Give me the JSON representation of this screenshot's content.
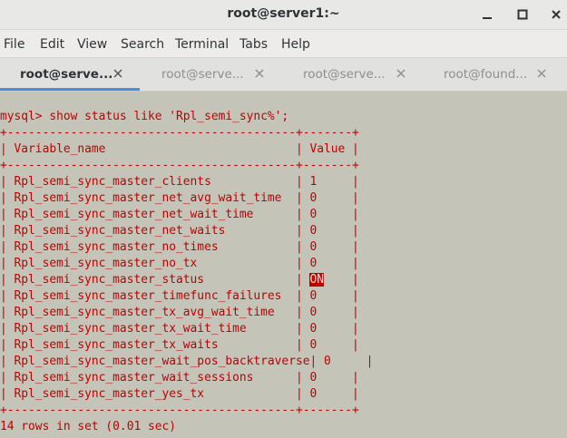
{
  "window": {
    "title": "root@server1:~"
  },
  "menu": [
    "File",
    "Edit",
    "View",
    "Search",
    "Terminal",
    "Tabs",
    "Help"
  ],
  "tabs": [
    {
      "label": "root@serve...",
      "active": true
    },
    {
      "label": "root@serve...",
      "active": false
    },
    {
      "label": "root@serve...",
      "active": false
    },
    {
      "label": "root@found...",
      "active": false
    }
  ],
  "terminal": {
    "command": "mysql> show status like 'Rpl_semi_sync%';",
    "border": "+-----------------------------------------+-------+",
    "header": "| Variable_name                           | Value |",
    "rows": [
      {
        "name": "Rpl_semi_sync_master_clients",
        "value": "1"
      },
      {
        "name": "Rpl_semi_sync_master_net_avg_wait_time",
        "value": "0"
      },
      {
        "name": "Rpl_semi_sync_master_net_wait_time",
        "value": "0"
      },
      {
        "name": "Rpl_semi_sync_master_net_waits",
        "value": "0"
      },
      {
        "name": "Rpl_semi_sync_master_no_times",
        "value": "0"
      },
      {
        "name": "Rpl_semi_sync_master_no_tx",
        "value": "0"
      },
      {
        "name": "Rpl_semi_sync_master_status",
        "value": "ON",
        "highlight": true
      },
      {
        "name": "Rpl_semi_sync_master_timefunc_failures",
        "value": "0"
      },
      {
        "name": "Rpl_semi_sync_master_tx_avg_wait_time",
        "value": "0"
      },
      {
        "name": "Rpl_semi_sync_master_tx_wait_time",
        "value": "0"
      },
      {
        "name": "Rpl_semi_sync_master_tx_waits",
        "value": "0"
      },
      {
        "name": "Rpl_semi_sync_master_wait_pos_backtraverse",
        "value": "0"
      },
      {
        "name": "Rpl_semi_sync_master_wait_sessions",
        "value": "0"
      },
      {
        "name": "Rpl_semi_sync_master_yes_tx",
        "value": "0"
      }
    ],
    "footer": "14 rows in set (0.01 sec)"
  },
  "colors": {
    "terminal_bg": "#c4c5b8",
    "terminal_fg": "#c00000",
    "accent": "#4a90d9"
  },
  "icons": [
    "minimize-icon",
    "maximize-icon",
    "close-icon",
    "tab-close-icon"
  ]
}
